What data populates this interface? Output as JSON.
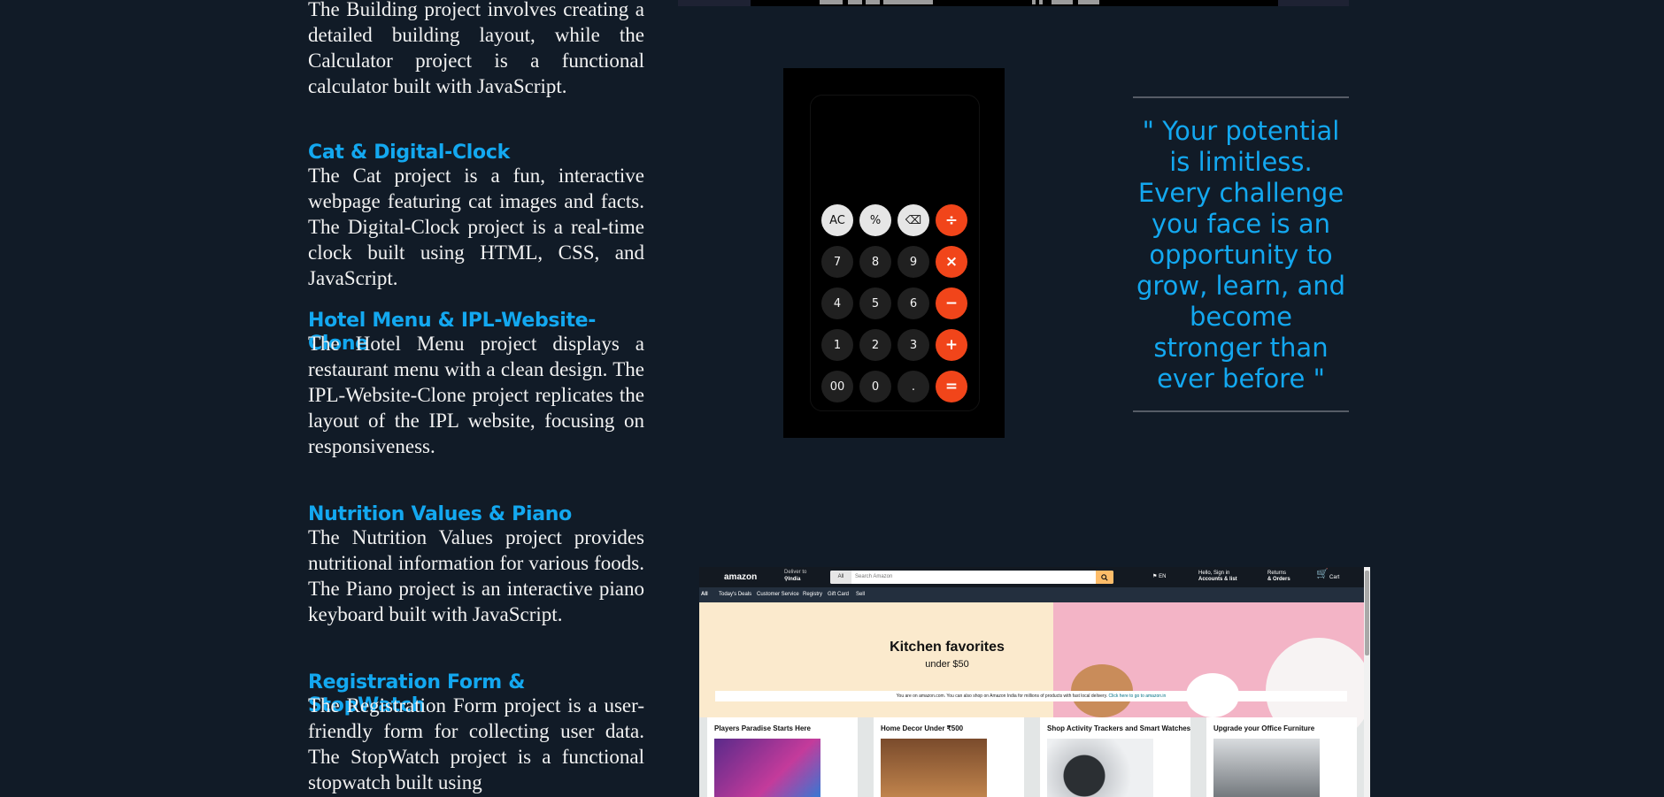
{
  "projects": {
    "intro_paragraph": "The Building project involves creating a detailed building layout, while the Calculator project is a functional calculator built with JavaScript.",
    "items": [
      {
        "title": "Cat & Digital-Clock",
        "description": "The Cat project is a fun, interactive webpage featuring cat images and facts. The Digital-Clock project is a real-time clock built using HTML, CSS, and JavaScript."
      },
      {
        "title": "Hotel Menu & IPL-Website-Clone",
        "description": "The Hotel Menu project displays a restaurant menu with a clean design. The IPL-Website-Clone project replicates the layout of the IPL website, focusing on responsiveness."
      },
      {
        "title": "Nutrition Values & Piano",
        "description": "The Nutrition Values project provides nutritional information for various foods. The Piano project is an interactive piano keyboard built with JavaScript."
      },
      {
        "title": "Registration Form & StopWatch",
        "description": "The Registration Form project is a user-friendly form for collecting user data. The StopWatch project is a functional stopwatch built using"
      }
    ]
  },
  "calculator": {
    "keys": [
      "AC",
      "%",
      "⌫",
      "÷",
      "7",
      "8",
      "9",
      "×",
      "4",
      "5",
      "6",
      "−",
      "1",
      "2",
      "3",
      "+",
      "00",
      "0",
      ".",
      "="
    ]
  },
  "quote": {
    "text": "\" Your potential is limitless. Every challenge you face is an opportunity to grow, learn, and become stronger than ever before \""
  },
  "amazon_preview": {
    "logo": "amazon",
    "deliver_to": "Deliver to",
    "deliver_location": "India",
    "search_category": "All",
    "search_placeholder": "Search Amazon",
    "language": "EN",
    "signin_line1": "Hello, Sign in",
    "signin_line2": "Accounts & list",
    "returns_line1": "Returns",
    "returns_line2": "& Orders",
    "cart": "Cart",
    "subnav": [
      "All",
      "Today's Deals",
      "Customer Service",
      "Registry",
      "Gift Card",
      "Sell"
    ],
    "hero_title": "Kitchen favorites",
    "hero_subtitle": "under $50",
    "notice_text": "You are on amazon.com. You can also shop on Amazon India for millions of products with fast local delivery.",
    "notice_link": "Click here to go to amazon.in",
    "cards": [
      "Players Paradise Starts Here",
      "Home Decor Under ₹500",
      "Shop Activity Trackers and Smart Watches",
      "Upgrade your Office Furniture"
    ],
    "colors": {
      "nav": "#131921",
      "subnav": "#232f3e",
      "search_button": "#febd69"
    }
  },
  "colors": {
    "page_background": "#111b27",
    "heading_accent": "#13a8f0",
    "operator_key": "#f1451a"
  }
}
